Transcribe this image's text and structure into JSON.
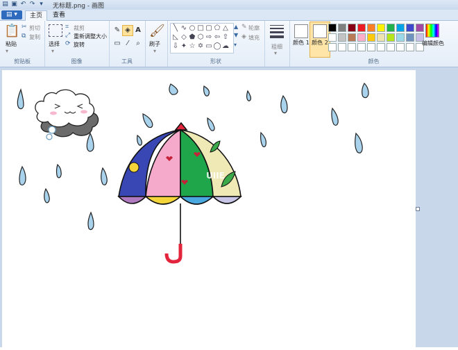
{
  "window": {
    "title": "无标题.png - 画图"
  },
  "file_button": "",
  "tabs": [
    {
      "label": "主页",
      "active": true
    },
    {
      "label": "查看",
      "active": false
    }
  ],
  "clipboard": {
    "paste": "粘贴",
    "cut": "剪切",
    "copy": "复制",
    "group": "剪贴板"
  },
  "image": {
    "select": "选择",
    "crop": "裁剪",
    "resize": "重新调整大小",
    "rotate": "旋转",
    "group": "图像"
  },
  "tools": {
    "group": "工具"
  },
  "brushes": {
    "label": "刷子"
  },
  "shapes": {
    "outline": "轮廓",
    "fill": "填充",
    "group": "形状"
  },
  "size": {
    "label": "粗细"
  },
  "colors": {
    "color1_label": "颜色 1",
    "color2_label": "颜色 2",
    "edit_label": "编辑颜色",
    "group": "颜色",
    "palette": [
      "#000000",
      "#7f7f7f",
      "#880015",
      "#ed1c24",
      "#ff7f27",
      "#fff200",
      "#22b14c",
      "#00a2e8",
      "#3f48cc",
      "#a349a4",
      "#ffffff",
      "#c3c3c3",
      "#b97a57",
      "#ffaec9",
      "#ffc90e",
      "#efe4b0",
      "#b5e61d",
      "#99d9ea",
      "#7092be",
      "#c8bfe7",
      "#ffffff",
      "#ffffff",
      "#ffffff",
      "#ffffff",
      "#ffffff",
      "#ffffff",
      "#ffffff",
      "#ffffff",
      "#ffffff",
      "#ffffff"
    ]
  },
  "canvas": {
    "watermark": "UIIE"
  }
}
